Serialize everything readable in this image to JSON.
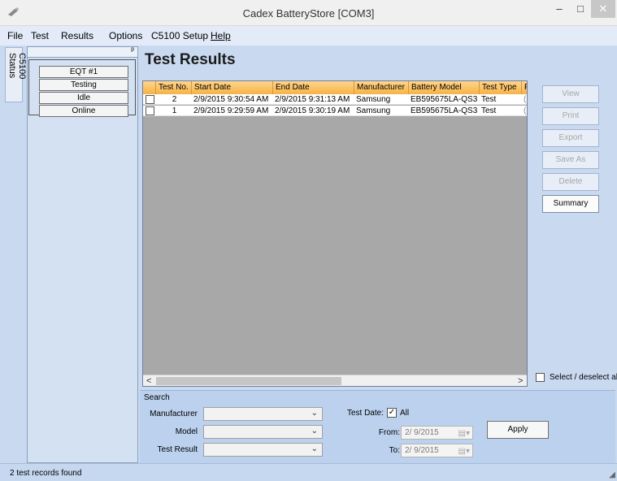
{
  "window": {
    "title": "Cadex BatteryStore [COM3]",
    "min_glyph": "–",
    "max_glyph": "□",
    "close_glyph": "✕"
  },
  "menu": [
    "File",
    "Test",
    "Results",
    "Options",
    "C5100 Setup",
    "Help"
  ],
  "side_tab": "C5100 Status",
  "status_panel": {
    "pin_glyph": "ᵖ",
    "cells": [
      "EQT #1",
      "Testing",
      "Idle",
      "Online"
    ]
  },
  "page_title": "Test Results",
  "grid": {
    "columns": [
      "",
      "Test No.",
      "Start Date",
      "End Date",
      "Manufacturer",
      "Battery Model",
      "Test Type",
      "F"
    ],
    "rows": [
      [
        "2",
        "2/9/2015 9:30:54 AM",
        "2/9/2015 9:31:13 AM",
        "Samsung",
        "EB595675LA-QS3",
        "Test",
        "("
      ],
      [
        "1",
        "2/9/2015 9:29:59 AM",
        "2/9/2015 9:30:19 AM",
        "Samsung",
        "EB595675LA-QS3",
        "Test",
        "("
      ]
    ],
    "scroll_left": "<",
    "scroll_right": ">"
  },
  "actions": {
    "view": "View",
    "print": "Print",
    "export": "Export",
    "save_as": "Save As",
    "delete": "Delete",
    "summary": "Summary"
  },
  "select_all_label": "Select / deselect all",
  "search": {
    "legend": "Search",
    "manufacturer_label": "Manufacturer",
    "model_label": "Model",
    "test_result_label": "Test Result",
    "test_date_label": "Test Date:",
    "all_label": "All",
    "all_checked": true,
    "from_label": "From:",
    "to_label": "To:",
    "from_value": "2/ 9/2015",
    "to_value": "2/ 9/2015",
    "apply": "Apply"
  },
  "status_bar": "2 test records found"
}
